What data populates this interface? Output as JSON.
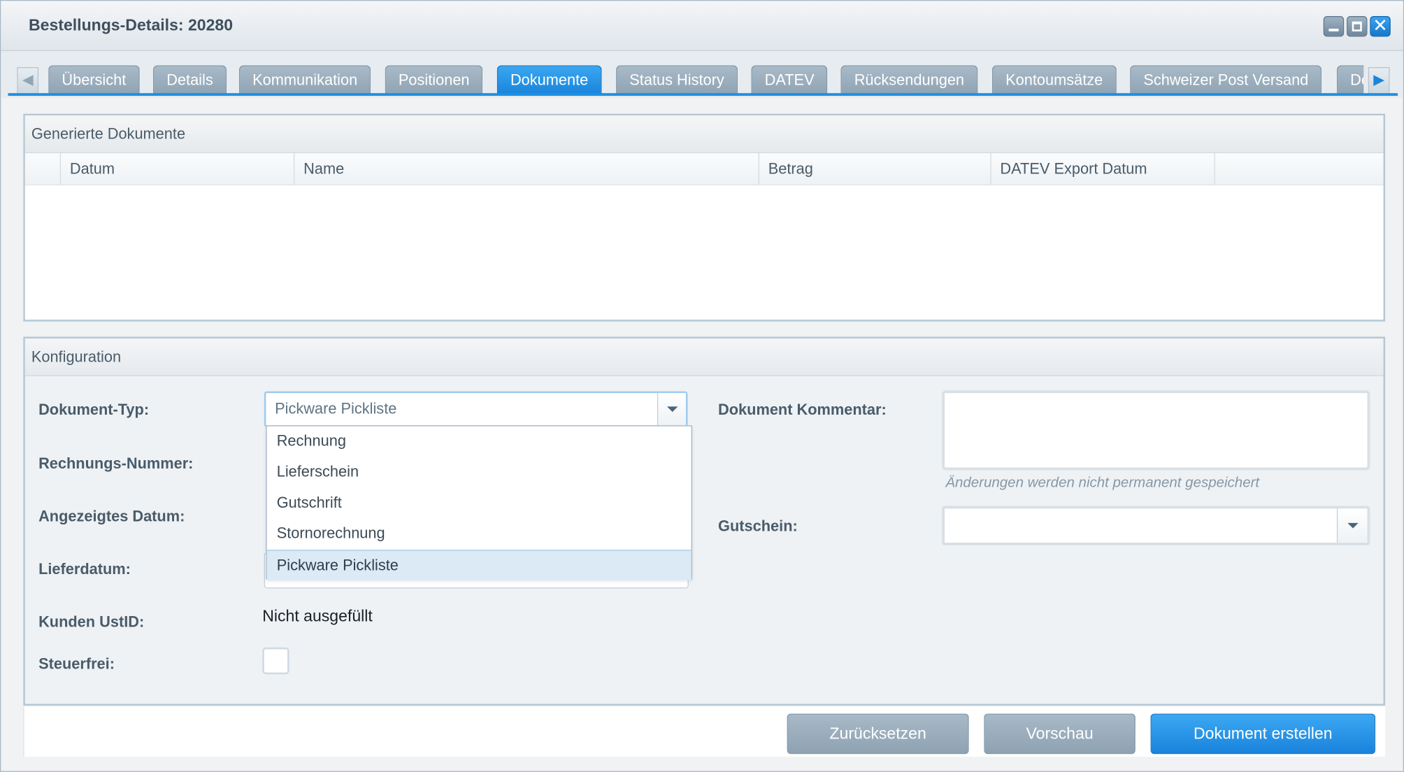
{
  "window": {
    "title": "Bestellungs-Details: 20280"
  },
  "tabs": [
    {
      "label": "Übersicht"
    },
    {
      "label": "Details"
    },
    {
      "label": "Kommunikation"
    },
    {
      "label": "Positionen"
    },
    {
      "label": "Dokumente",
      "active": true
    },
    {
      "label": "Status History"
    },
    {
      "label": "DATEV"
    },
    {
      "label": "Rücksendungen"
    },
    {
      "label": "Kontoumsätze"
    },
    {
      "label": "Schweizer Post Versand"
    },
    {
      "label": "De"
    }
  ],
  "documents": {
    "title": "Generierte Dokumente",
    "columns": [
      "",
      "Datum",
      "Name",
      "Betrag",
      "DATEV Export Datum",
      ""
    ],
    "rows": []
  },
  "config": {
    "title": "Konfiguration",
    "doc_type_label": "Dokument-Typ:",
    "doc_type_value": "Pickware Pickliste",
    "invoice_number_label": "Rechnungs-Nummer:",
    "display_date_label": "Angezeigtes Datum:",
    "delivery_date_label": "Lieferdatum:",
    "customer_vat_label": "Kunden UstID:",
    "customer_vat_value": "Nicht ausgefüllt",
    "tax_free_label": "Steuerfrei:",
    "comment_label": "Dokument Kommentar:",
    "comment_hint": "Änderungen werden nicht permanent gespeichert",
    "voucher_label": "Gutschein:",
    "doc_type_options": [
      "Rechnung",
      "Lieferschein",
      "Gutschrift",
      "Stornorechnung",
      "Pickware Pickliste"
    ]
  },
  "buttons": {
    "reset": "Zurücksetzen",
    "preview": "Vorschau",
    "create": "Dokument erstellen"
  },
  "colors": {
    "accent": "#1e8fe4",
    "tab_inactive": "#9aaebd"
  }
}
